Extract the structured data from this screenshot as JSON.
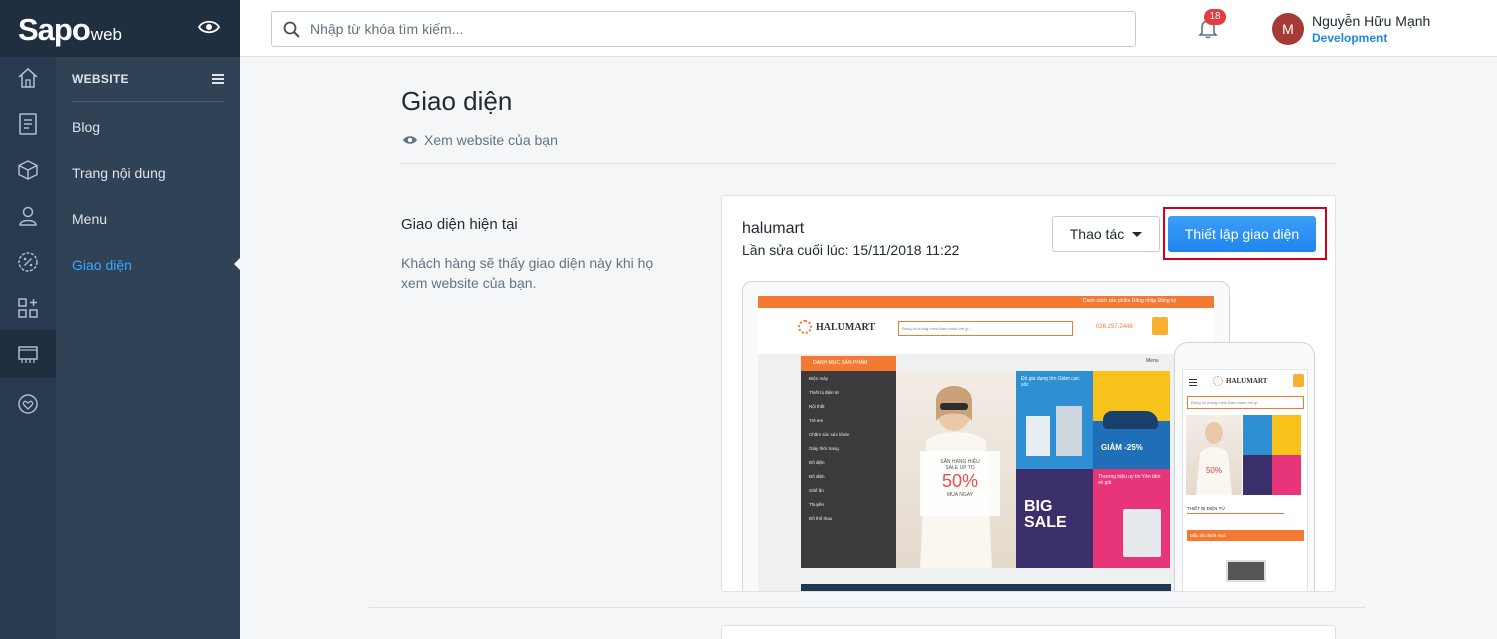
{
  "app": {
    "logo_main": "Sapo",
    "logo_sub": "web"
  },
  "sidebar": {
    "section_title": "WEBSITE",
    "items": [
      {
        "label": "Blog",
        "active": false
      },
      {
        "label": "Trang nội dung",
        "active": false
      },
      {
        "label": "Menu",
        "active": false
      },
      {
        "label": "Giao diện",
        "active": true
      }
    ]
  },
  "rail": {
    "icons": [
      "home-icon",
      "orders-icon",
      "products-icon",
      "customers-icon",
      "promotions-icon",
      "apps-icon",
      "website-icon",
      "support-icon"
    ],
    "active": "website-icon"
  },
  "header": {
    "search_placeholder": "Nhập từ khóa tìm kiếm...",
    "notification_count": "18",
    "user_initial": "M",
    "user_name": "Nguyễn Hữu Mạnh",
    "user_role": "Development"
  },
  "main": {
    "title": "Giao diện",
    "view_site_link": "Xem website của bạn",
    "current_theme": {
      "section_title": "Giao diện hiện tại",
      "section_description": "Khách hàng sẽ thấy giao diện này khi họ xem website của bạn.",
      "theme_name": "halumart",
      "last_updated": "Lần sửa cuối lúc: 15/11/2018 11:22",
      "actions_label": "Thao tác",
      "setup_label": "Thiết lập giao diện"
    }
  },
  "preview": {
    "brand": "HALUMART",
    "top_links": "Danh sách sản phẩm   Đăng nhập   Đăng ký",
    "search_placeholder": "Đồng hồ thông minh     Bạn muốn tìm gì...",
    "phone": "026.257.2448",
    "menu_label": "Menu",
    "category_title": "DANH MỤC SẢN PHẨM",
    "categories": [
      "Điện máy",
      "Thiết bị điện tử",
      "Nội thất",
      "Trẻ em",
      "Chăm sóc sức khỏe",
      "Giày thời trang",
      "Đồ điện",
      "Đồ điện",
      "Ghế ăn",
      "Thuyền",
      "Đồ thể thao"
    ],
    "hero_label": "SĂN HÀNG HIỆU",
    "hero_sub": "SALE UP TO",
    "hero_discount": "50%",
    "hero_button": "MUA NGAY",
    "tile_home_appliance": "Đồ gia dụng lớn Giảm cực sốc",
    "tile_discount": "GIẢM -25%",
    "tile_big_sale": "BIG SALE",
    "tile_brand": "Thương hiệu uy tín Yên tâm về giá",
    "phone_section": "THIẾT BỊ ĐIỆN TỬ",
    "phone_category": "Mẫu đa danh mục"
  },
  "colors": {
    "accent": "#1f85ef",
    "highlight": "#d0021b",
    "preview_orange": "#f47a33"
  }
}
